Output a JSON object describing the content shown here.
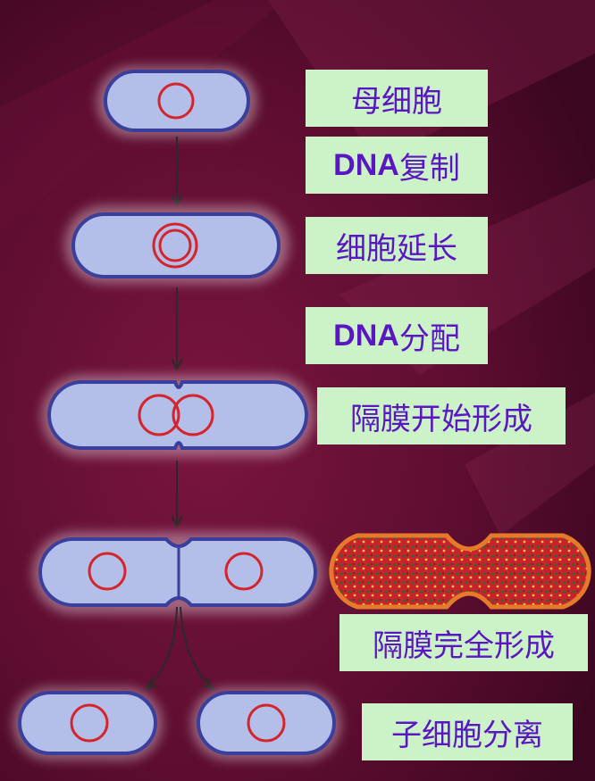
{
  "stages": [
    {
      "id": "mother",
      "label": "母细胞"
    },
    {
      "id": "dna-replication",
      "label_prefix": "DNA",
      "label_suffix": "复制"
    },
    {
      "id": "elongation",
      "label": "细胞延长"
    },
    {
      "id": "dna-distribution",
      "label_prefix": "DNA",
      "label_suffix": "分配"
    },
    {
      "id": "septum-begin",
      "label": "隔膜开始形成"
    },
    {
      "id": "septum-complete",
      "label": "隔膜完全形成"
    },
    {
      "id": "separation",
      "label": "子细胞分离"
    }
  ],
  "colors": {
    "background": "#5a0b2c",
    "label_bg": "#ccf2c8",
    "label_text": "#5a16c2",
    "cell_fill": "#b3bfe8",
    "cell_outline": "#3a3f9c",
    "nucleoid": "#d4242c",
    "arrow": "#2a2a2a"
  }
}
